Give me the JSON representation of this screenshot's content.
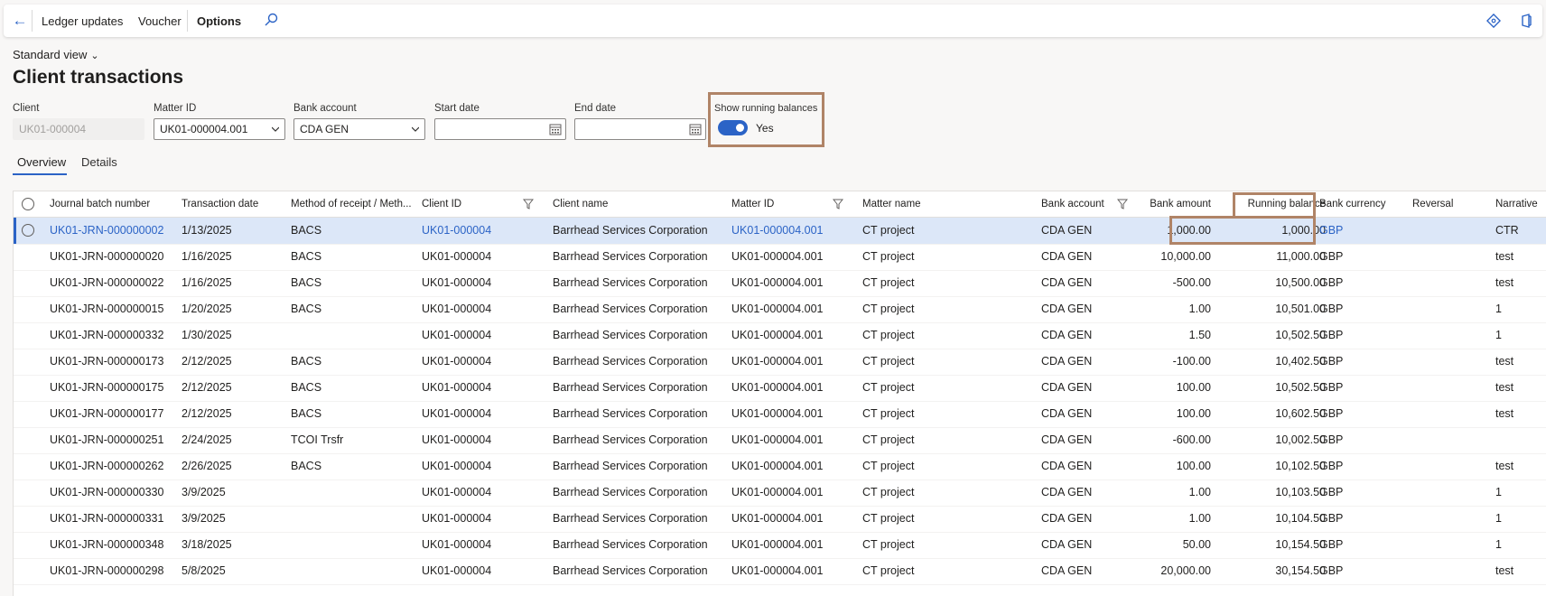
{
  "actionbar": {
    "items": [
      "Ledger updates",
      "Voucher",
      "Options"
    ]
  },
  "view_selector": "Standard view",
  "page_title": "Client transactions",
  "filters": {
    "client": {
      "label": "Client",
      "value": "UK01-000004"
    },
    "matter_id": {
      "label": "Matter ID",
      "value": "UK01-000004.001"
    },
    "bank_account": {
      "label": "Bank account",
      "value": "CDA GEN"
    },
    "start_date": {
      "label": "Start date",
      "value": ""
    },
    "end_date": {
      "label": "End date",
      "value": ""
    },
    "running_balances": {
      "label": "Show running balances",
      "value": "Yes"
    }
  },
  "tabs": [
    "Overview",
    "Details"
  ],
  "grid": {
    "columns": [
      "Journal batch number",
      "Transaction date",
      "Method of receipt / Meth...",
      "Client ID",
      "Client name",
      "Matter ID",
      "Matter name",
      "Bank account",
      "Bank amount",
      "Running balance",
      "Bank currency",
      "Reversal",
      "Narrative"
    ],
    "rows": [
      [
        "UK01-JRN-000000002",
        "1/13/2025",
        "BACS",
        "UK01-000004",
        "Barrhead Services Corporation",
        "UK01-000004.001",
        "CT project",
        "CDA GEN",
        "1,000.00",
        "1,000.00",
        "GBP",
        "",
        "CTR"
      ],
      [
        "UK01-JRN-000000020",
        "1/16/2025",
        "BACS",
        "UK01-000004",
        "Barrhead Services Corporation",
        "UK01-000004.001",
        "CT project",
        "CDA GEN",
        "10,000.00",
        "11,000.00",
        "GBP",
        "",
        "test"
      ],
      [
        "UK01-JRN-000000022",
        "1/16/2025",
        "BACS",
        "UK01-000004",
        "Barrhead Services Corporation",
        "UK01-000004.001",
        "CT project",
        "CDA GEN",
        "-500.00",
        "10,500.00",
        "GBP",
        "",
        "test"
      ],
      [
        "UK01-JRN-000000015",
        "1/20/2025",
        "BACS",
        "UK01-000004",
        "Barrhead Services Corporation",
        "UK01-000004.001",
        "CT project",
        "CDA GEN",
        "1.00",
        "10,501.00",
        "GBP",
        "",
        "1"
      ],
      [
        "UK01-JRN-000000332",
        "1/30/2025",
        "",
        "UK01-000004",
        "Barrhead Services Corporation",
        "UK01-000004.001",
        "CT project",
        "CDA GEN",
        "1.50",
        "10,502.50",
        "GBP",
        "",
        "1"
      ],
      [
        "UK01-JRN-000000173",
        "2/12/2025",
        "BACS",
        "UK01-000004",
        "Barrhead Services Corporation",
        "UK01-000004.001",
        "CT project",
        "CDA GEN",
        "-100.00",
        "10,402.50",
        "GBP",
        "",
        "test"
      ],
      [
        "UK01-JRN-000000175",
        "2/12/2025",
        "BACS",
        "UK01-000004",
        "Barrhead Services Corporation",
        "UK01-000004.001",
        "CT project",
        "CDA GEN",
        "100.00",
        "10,502.50",
        "GBP",
        "",
        "test"
      ],
      [
        "UK01-JRN-000000177",
        "2/12/2025",
        "BACS",
        "UK01-000004",
        "Barrhead Services Corporation",
        "UK01-000004.001",
        "CT project",
        "CDA GEN",
        "100.00",
        "10,602.50",
        "GBP",
        "",
        "test"
      ],
      [
        "UK01-JRN-000000251",
        "2/24/2025",
        "TCOI Trsfr",
        "UK01-000004",
        "Barrhead Services Corporation",
        "UK01-000004.001",
        "CT project",
        "CDA GEN",
        "-600.00",
        "10,002.50",
        "GBP",
        "",
        ""
      ],
      [
        "UK01-JRN-000000262",
        "2/26/2025",
        "BACS",
        "UK01-000004",
        "Barrhead Services Corporation",
        "UK01-000004.001",
        "CT project",
        "CDA GEN",
        "100.00",
        "10,102.50",
        "GBP",
        "",
        "test"
      ],
      [
        "UK01-JRN-000000330",
        "3/9/2025",
        "",
        "UK01-000004",
        "Barrhead Services Corporation",
        "UK01-000004.001",
        "CT project",
        "CDA GEN",
        "1.00",
        "10,103.50",
        "GBP",
        "",
        "1"
      ],
      [
        "UK01-JRN-000000331",
        "3/9/2025",
        "",
        "UK01-000004",
        "Barrhead Services Corporation",
        "UK01-000004.001",
        "CT project",
        "CDA GEN",
        "1.00",
        "10,104.50",
        "GBP",
        "",
        "1"
      ],
      [
        "UK01-JRN-000000348",
        "3/18/2025",
        "",
        "UK01-000004",
        "Barrhead Services Corporation",
        "UK01-000004.001",
        "CT project",
        "CDA GEN",
        "50.00",
        "10,154.50",
        "GBP",
        "",
        "1"
      ],
      [
        "UK01-JRN-000000298",
        "5/8/2025",
        "",
        "UK01-000004",
        "Barrhead Services Corporation",
        "UK01-000004.001",
        "CT project",
        "CDA GEN",
        "20,000.00",
        "30,154.50",
        "GBP",
        "",
        "test"
      ]
    ],
    "selected_row": 0
  },
  "colors": {
    "accent": "#2b63c6",
    "highlight_box": "#b08467",
    "selected_row": "#dce7f8"
  }
}
